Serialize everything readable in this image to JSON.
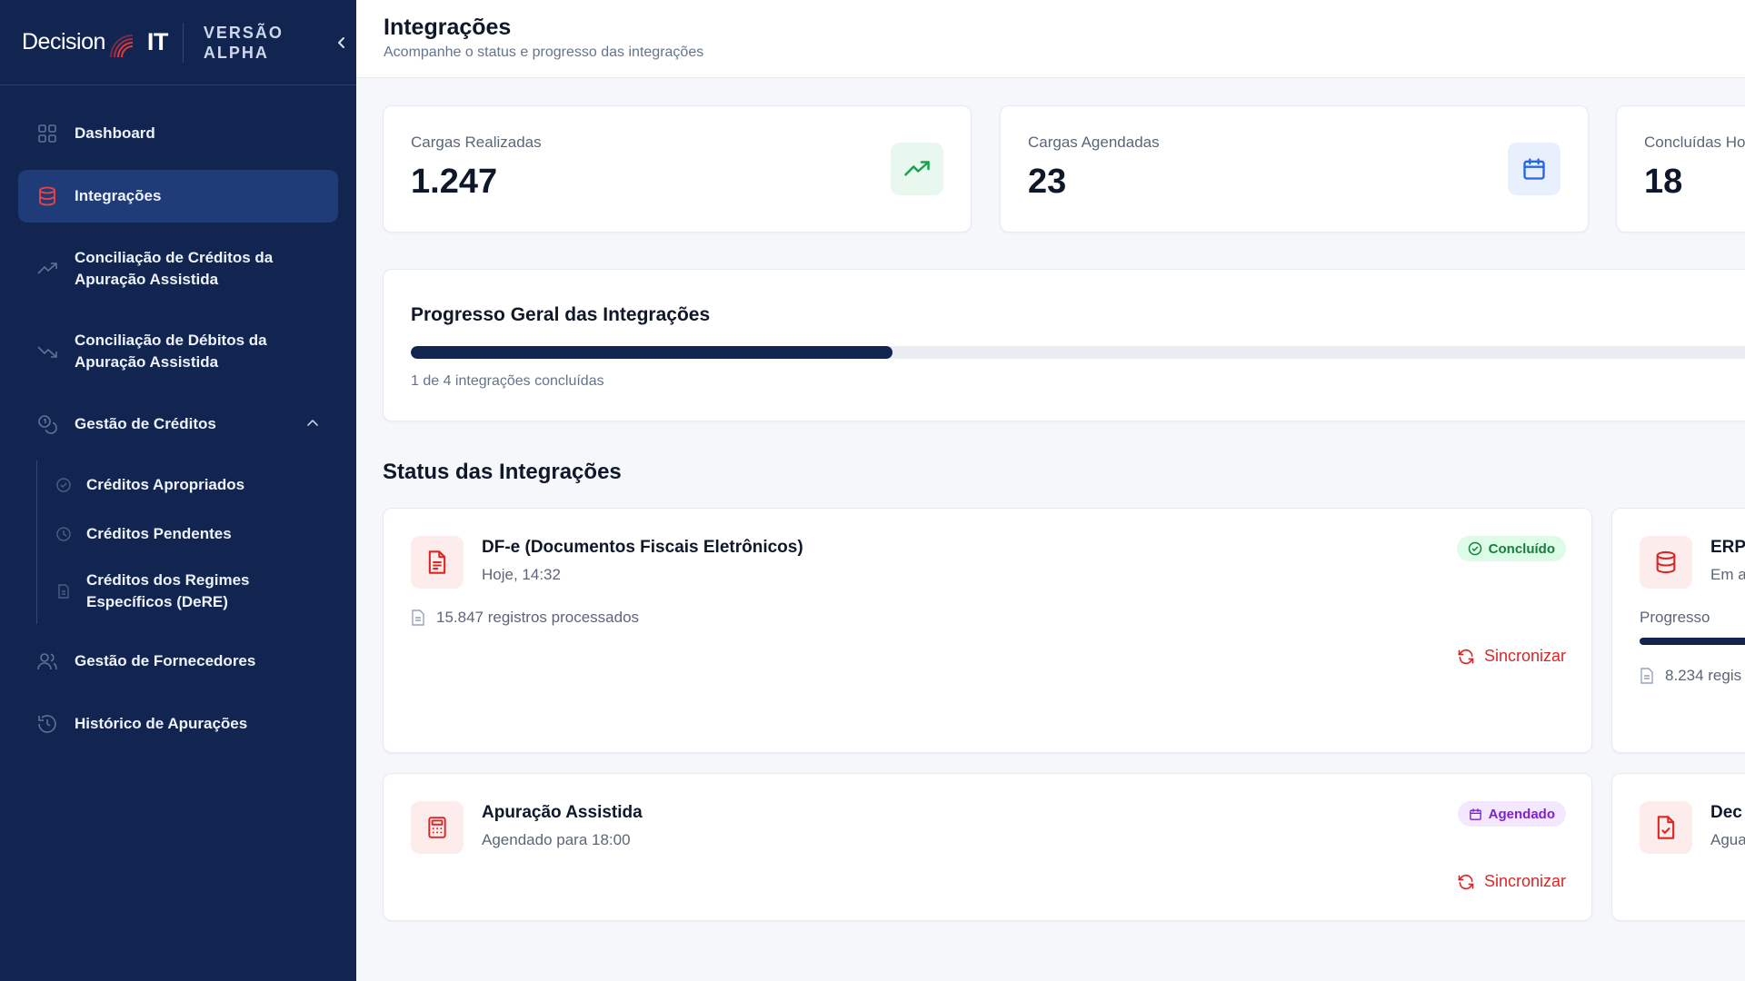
{
  "brand": {
    "name_part1": "Decision",
    "name_part2": "IT",
    "version_label": "VERSÃO ALPHA"
  },
  "sidebar": {
    "items": [
      {
        "label": "Dashboard",
        "icon": "grid-icon"
      },
      {
        "label": "Integrações",
        "icon": "database-icon",
        "active": true
      },
      {
        "label": "Conciliação de Créditos da Apuração Assistida",
        "icon": "trending-up-icon"
      },
      {
        "label": "Conciliação de Débitos da Apuração Assistida",
        "icon": "trending-down-icon"
      },
      {
        "label": "Gestão de Créditos",
        "icon": "coins-icon",
        "expanded": true
      },
      {
        "label": "Gestão de Fornecedores",
        "icon": "users-icon"
      },
      {
        "label": "Histórico de Apurações",
        "icon": "history-icon"
      }
    ],
    "subitems": [
      {
        "label": "Créditos Apropriados",
        "icon": "check-circle-icon"
      },
      {
        "label": "Créditos Pendentes",
        "icon": "clock-icon"
      },
      {
        "label": "Créditos dos Regimes Específicos (DeRE)",
        "icon": "file-icon"
      }
    ]
  },
  "header": {
    "title": "Integrações",
    "subtitle": "Acompanhe o status e progresso das integrações"
  },
  "stats": [
    {
      "label": "Cargas Realizadas",
      "value": "1.247",
      "icon": "trend-up-icon",
      "accent": "#16a34a"
    },
    {
      "label": "Cargas Agendadas",
      "value": "23",
      "icon": "calendar-icon",
      "accent": "#2563eb"
    },
    {
      "label": "Concluídas Ho",
      "value": "18"
    }
  ],
  "progress": {
    "title": "Progresso Geral das Integrações",
    "note": "1 de 4 integrações concluídas",
    "completed": 1,
    "total": 4
  },
  "section_title": "Status das Integrações",
  "integrations": [
    {
      "title": "DF-e (Documentos Fiscais Eletrônicos)",
      "subtitle": "Hoje, 14:32",
      "records": "15.847 registros processados",
      "status": "Concluído",
      "action": "Sincronizar",
      "icon": "file-text-icon"
    },
    {
      "title": "ERP",
      "subtitle": "Em a",
      "progress_label": "Progresso",
      "records": "8.234 regis",
      "icon": "database-icon"
    },
    {
      "title": "Apuração Assistida",
      "subtitle": "Agendado para 18:00",
      "status": "Agendado",
      "action": "Sincronizar",
      "icon": "calculator-icon"
    },
    {
      "title": "Dec",
      "subtitle": "Agua",
      "icon": "file-check-icon"
    }
  ],
  "colors": {
    "sidebar_bg": "#112550",
    "active_item": "#1f3c78",
    "danger": "#dc2626",
    "success": "#15803d",
    "scheduled": "#7e22ce"
  }
}
